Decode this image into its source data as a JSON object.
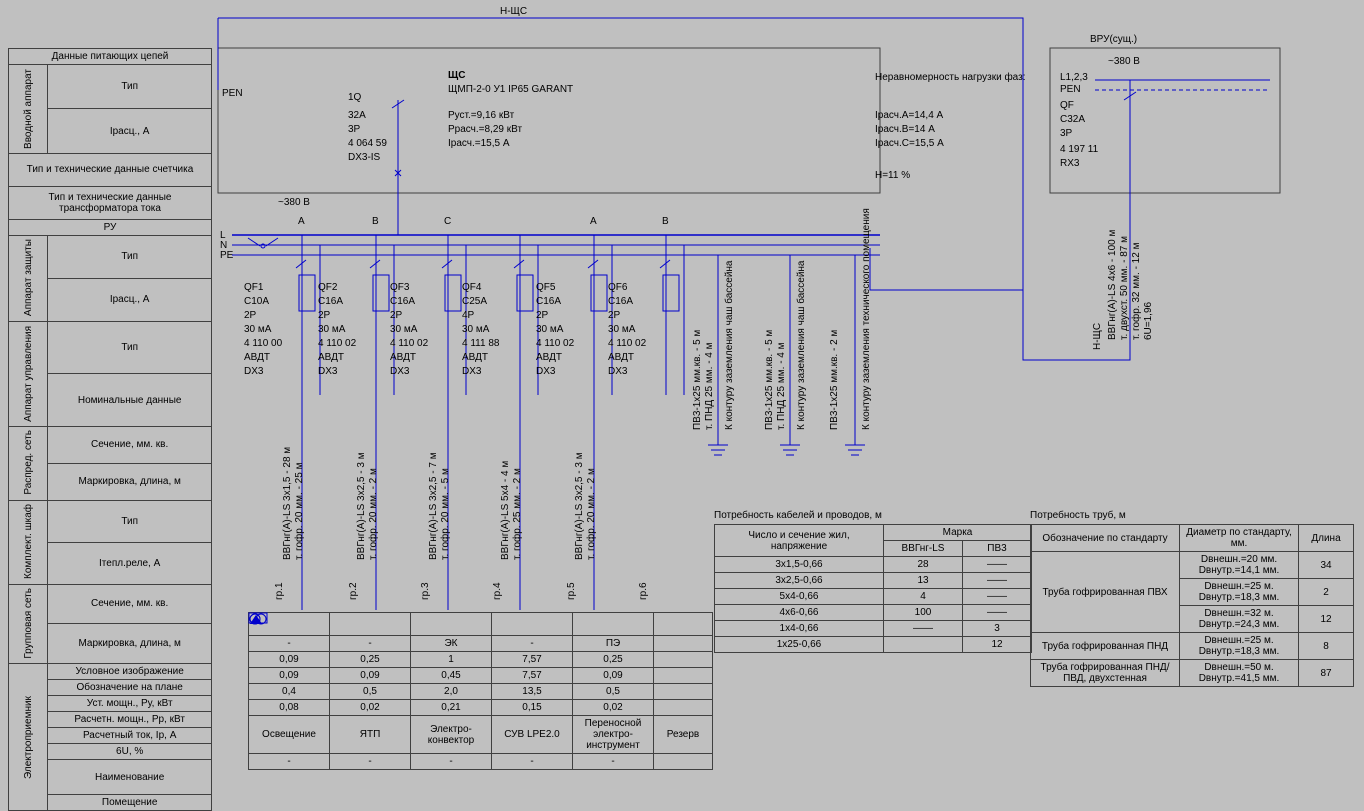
{
  "title": "Н-ЩС",
  "vru": {
    "title": "ВРУ(сущ.)",
    "volt": "~380 В",
    "l": "L1,2,3",
    "pen": "PEN",
    "qf": "QF",
    "c": "C32A",
    "p": "3P",
    "code": "4 197 11",
    "rx": "RX3",
    "cable": "ВВГнг(А)-LS 4x6 - 100 м",
    "d1": "т. двухст. 50 мм. - 87 м",
    "d2": "т. гофр. 32 мм. - 12 м",
    "gu": "6U=1,96",
    "nsch": "Н-ЩС"
  },
  "panel": {
    "name": "ЩС",
    "model": "ЩМП-2-0 У1 IP65 GARANT",
    "p1": "Руст.=9,16 кВт",
    "p2": "Ррасч.=8,29 кВт",
    "p3": "Iрасч.=15,5 А"
  },
  "input": {
    "q": "1Q",
    "a": "32A",
    "p": "3P",
    "code": "4 064 59",
    "dx": "DX3-IS",
    "volt": "~380 В",
    "pen": "PEN",
    "l": "L",
    "n": "N",
    "pe": "PE"
  },
  "phases": {
    "hdr": "Неравномерность нагрузки фаз:",
    "a": "Iрасч.А=14,4 А",
    "b": "Iрасч.В=14 А",
    "c": "Iрасч.С=15,5 А",
    "h": "H=11 %"
  },
  "bus_phases": [
    "A",
    "B",
    "C",
    "A",
    "B"
  ],
  "breakers": [
    {
      "qf": "QF1",
      "c": "C10A",
      "p": "2P",
      "ma": "30 мА",
      "code": "4 110 00",
      "avdt": "АВДТ",
      "dx": "DX3",
      "cable": "ВВГнг(А)-LS 3x1,5 - 28 м",
      "pipe": "т. гофр. 20 мм. - 25 м",
      "gr": "гр.1"
    },
    {
      "qf": "QF2",
      "c": "C16A",
      "p": "2P",
      "ma": "30 мА",
      "code": "4 110 02",
      "avdt": "АВДТ",
      "dx": "DX3",
      "cable": "ВВГнг(А)-LS 3x2,5 - 3 м",
      "pipe": "т. гофр. 20 мм. - 2 м",
      "gr": "гр.2"
    },
    {
      "qf": "QF3",
      "c": "C16A",
      "p": "2P",
      "ma": "30 мА",
      "code": "4 110 02",
      "avdt": "АВДТ",
      "dx": "DX3",
      "cable": "ВВГнг(А)-LS 3x2,5 - 7 м",
      "pipe": "т. гофр. 20 мм. - 5 м",
      "gr": "гр.3"
    },
    {
      "qf": "QF4",
      "c": "C25A",
      "p": "4P",
      "ma": "30 мА",
      "code": "4 111 88",
      "avdt": "АВДТ",
      "dx": "DX3",
      "cable": "ВВГнг(А)-LS 5x4 - 4 м",
      "pipe": "т. гофр. 25 мм. - 2 м",
      "gr": "гр.4"
    },
    {
      "qf": "QF5",
      "c": "C16A",
      "p": "2P",
      "ma": "30 мА",
      "code": "4 110 02",
      "avdt": "АВДТ",
      "dx": "DX3",
      "cable": "ВВГнг(А)-LS 3x2,5 - 3 м",
      "pipe": "т. гофр. 20 мм. - 2 м",
      "gr": "гр.5"
    },
    {
      "qf": "QF6",
      "c": "C16A",
      "p": "2P",
      "ma": "30 мА",
      "code": "4 110 02",
      "avdt": "АВДТ",
      "dx": "DX3",
      "gr": "гр.6"
    }
  ],
  "earths": [
    {
      "c": "ПВ3-1x25 мм.кв. - 5 м",
      "p": "т. ПНД 25 мм. - 4 м",
      "t": "К контуру заземления чаш бассейна"
    },
    {
      "c": "ПВ3-1x25 мм.кв. - 5 м",
      "p": "т. ПНД 25 мм. - 4 м",
      "t": "К контуру заземления чаш бассейна"
    },
    {
      "c": "ПВ3-1x25 мм.кв. - 2 м",
      "p": "",
      "t": "К контуру заземления технического помещения"
    }
  ],
  "side": {
    "header": "Данные питающих цепей",
    "vvod": {
      "cat": "Вводной аппарат",
      "rows": [
        "Тип",
        "Iрасц., А"
      ]
    },
    "meter": "Тип и технические данные счетчика",
    "ct": "Тип и технические данные трансформатора тока",
    "ru": "РУ",
    "prot": {
      "cat": "Аппарат защиты",
      "rows": [
        "Тип",
        "Iрасц., А"
      ]
    },
    "ctrl": {
      "cat": "Аппарат управления",
      "rows": [
        "Тип",
        "Номинальные данные"
      ]
    },
    "dist": {
      "cat": "Распред. сеть",
      "rows": [
        "Сечение, мм. кв.",
        "Маркировка, длина, м"
      ]
    },
    "komp": {
      "cat": "Комплект. шкаф",
      "rows": [
        "Тип",
        "Iтепл.реле, А"
      ]
    },
    "grp": {
      "cat": "Групповая сеть",
      "rows": [
        "Сечение, мм. кв.",
        "Маркировка, длина, м"
      ]
    },
    "ep": {
      "cat": "Электроприемник",
      "rows": [
        "Условное изображение",
        "Обозначение на плане",
        "Уст. мощн., Ру, кВт",
        "Расчетн. мощн., Рр, кВт",
        "Расчетный ток, Iр, А",
        "6U, %",
        "Наименование",
        "Помещение"
      ]
    }
  },
  "bottom": {
    "cols": [
      "Освещение",
      "ЯТП",
      "Электро-конвектор",
      "СУВ LPE2.0",
      "Переносной электро-инструмент",
      "Резерв"
    ],
    "plan": [
      "-",
      "-",
      "ЭК",
      "-",
      "ПЭ",
      ""
    ],
    "pu": [
      "0,09",
      "0,25",
      "1",
      "7,57",
      "0,25",
      ""
    ],
    "pr": [
      "0,09",
      "0,09",
      "0,45",
      "7,57",
      "0,09",
      ""
    ],
    "ip": [
      "0,4",
      "0,5",
      "2,0",
      "13,5",
      "0,5",
      ""
    ],
    "gu": [
      "0,08",
      "0,02",
      "0,21",
      "0,15",
      "0,02",
      ""
    ]
  },
  "cables": {
    "title": "Потребность кабелей и проводов, м",
    "h1": "Число и сечение жил, напряжение",
    "h2": "Марка",
    "h2a": "ВВГнг-LS",
    "h2b": "ПВ3",
    "rows": [
      [
        "3x1,5-0,66",
        "28",
        "——"
      ],
      [
        "3x2,5-0,66",
        "13",
        "——"
      ],
      [
        "5x4-0,66",
        "4",
        "——"
      ],
      [
        "4x6-0,66",
        "100",
        "——"
      ],
      [
        "1x4-0,66",
        "——",
        "3"
      ],
      [
        "1x25-0,66",
        "",
        "12"
      ]
    ]
  },
  "pipes": {
    "title": "Потребность труб, м",
    "h1": "Обозначение по стандарту",
    "h2": "Диаметр по стандарту, мм.",
    "h3": "Длина",
    "rows": [
      [
        "Труба гофрированная ПВХ",
        "Dвнешн.=20 мм. Dвнутр.=14,1 мм.",
        "34"
      ],
      [
        "",
        "Dвнешн.=25 м. Dвнутр.=18,3 мм.",
        "2"
      ],
      [
        "",
        "Dвнешн.=32 м. Dвнутр.=24,3 мм.",
        "12"
      ],
      [
        "Труба гофрированная ПНД",
        "Dвнешн.=25 м. Dвнутр.=18,3 мм.",
        "8"
      ],
      [
        "Труба гофрированная ПНД/ПВД, двухстенная",
        "Dвнешн.=50 м. Dвнутр.=41,5 мм.",
        "87"
      ]
    ]
  }
}
